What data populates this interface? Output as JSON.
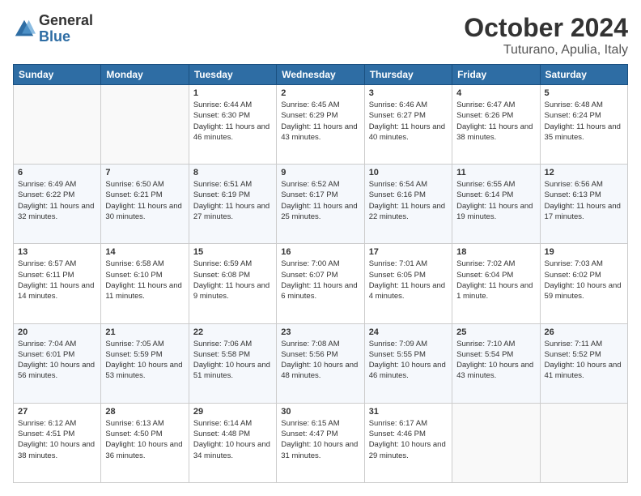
{
  "logo": {
    "general": "General",
    "blue": "Blue"
  },
  "title": "October 2024",
  "location": "Tuturano, Apulia, Italy",
  "weekdays": [
    "Sunday",
    "Monday",
    "Tuesday",
    "Wednesday",
    "Thursday",
    "Friday",
    "Saturday"
  ],
  "weeks": [
    [
      {
        "day": null
      },
      {
        "day": null
      },
      {
        "day": 1,
        "sunrise": "6:44 AM",
        "sunset": "6:30 PM",
        "daylight": "11 hours and 46 minutes."
      },
      {
        "day": 2,
        "sunrise": "6:45 AM",
        "sunset": "6:29 PM",
        "daylight": "11 hours and 43 minutes."
      },
      {
        "day": 3,
        "sunrise": "6:46 AM",
        "sunset": "6:27 PM",
        "daylight": "11 hours and 40 minutes."
      },
      {
        "day": 4,
        "sunrise": "6:47 AM",
        "sunset": "6:26 PM",
        "daylight": "11 hours and 38 minutes."
      },
      {
        "day": 5,
        "sunrise": "6:48 AM",
        "sunset": "6:24 PM",
        "daylight": "11 hours and 35 minutes."
      }
    ],
    [
      {
        "day": 6,
        "sunrise": "6:49 AM",
        "sunset": "6:22 PM",
        "daylight": "11 hours and 32 minutes."
      },
      {
        "day": 7,
        "sunrise": "6:50 AM",
        "sunset": "6:21 PM",
        "daylight": "11 hours and 30 minutes."
      },
      {
        "day": 8,
        "sunrise": "6:51 AM",
        "sunset": "6:19 PM",
        "daylight": "11 hours and 27 minutes."
      },
      {
        "day": 9,
        "sunrise": "6:52 AM",
        "sunset": "6:17 PM",
        "daylight": "11 hours and 25 minutes."
      },
      {
        "day": 10,
        "sunrise": "6:54 AM",
        "sunset": "6:16 PM",
        "daylight": "11 hours and 22 minutes."
      },
      {
        "day": 11,
        "sunrise": "6:55 AM",
        "sunset": "6:14 PM",
        "daylight": "11 hours and 19 minutes."
      },
      {
        "day": 12,
        "sunrise": "6:56 AM",
        "sunset": "6:13 PM",
        "daylight": "11 hours and 17 minutes."
      }
    ],
    [
      {
        "day": 13,
        "sunrise": "6:57 AM",
        "sunset": "6:11 PM",
        "daylight": "11 hours and 14 minutes."
      },
      {
        "day": 14,
        "sunrise": "6:58 AM",
        "sunset": "6:10 PM",
        "daylight": "11 hours and 11 minutes."
      },
      {
        "day": 15,
        "sunrise": "6:59 AM",
        "sunset": "6:08 PM",
        "daylight": "11 hours and 9 minutes."
      },
      {
        "day": 16,
        "sunrise": "7:00 AM",
        "sunset": "6:07 PM",
        "daylight": "11 hours and 6 minutes."
      },
      {
        "day": 17,
        "sunrise": "7:01 AM",
        "sunset": "6:05 PM",
        "daylight": "11 hours and 4 minutes."
      },
      {
        "day": 18,
        "sunrise": "7:02 AM",
        "sunset": "6:04 PM",
        "daylight": "11 hours and 1 minute."
      },
      {
        "day": 19,
        "sunrise": "7:03 AM",
        "sunset": "6:02 PM",
        "daylight": "10 hours and 59 minutes."
      }
    ],
    [
      {
        "day": 20,
        "sunrise": "7:04 AM",
        "sunset": "6:01 PM",
        "daylight": "10 hours and 56 minutes."
      },
      {
        "day": 21,
        "sunrise": "7:05 AM",
        "sunset": "5:59 PM",
        "daylight": "10 hours and 53 minutes."
      },
      {
        "day": 22,
        "sunrise": "7:06 AM",
        "sunset": "5:58 PM",
        "daylight": "10 hours and 51 minutes."
      },
      {
        "day": 23,
        "sunrise": "7:08 AM",
        "sunset": "5:56 PM",
        "daylight": "10 hours and 48 minutes."
      },
      {
        "day": 24,
        "sunrise": "7:09 AM",
        "sunset": "5:55 PM",
        "daylight": "10 hours and 46 minutes."
      },
      {
        "day": 25,
        "sunrise": "7:10 AM",
        "sunset": "5:54 PM",
        "daylight": "10 hours and 43 minutes."
      },
      {
        "day": 26,
        "sunrise": "7:11 AM",
        "sunset": "5:52 PM",
        "daylight": "10 hours and 41 minutes."
      }
    ],
    [
      {
        "day": 27,
        "sunrise": "6:12 AM",
        "sunset": "4:51 PM",
        "daylight": "10 hours and 38 minutes."
      },
      {
        "day": 28,
        "sunrise": "6:13 AM",
        "sunset": "4:50 PM",
        "daylight": "10 hours and 36 minutes."
      },
      {
        "day": 29,
        "sunrise": "6:14 AM",
        "sunset": "4:48 PM",
        "daylight": "10 hours and 34 minutes."
      },
      {
        "day": 30,
        "sunrise": "6:15 AM",
        "sunset": "4:47 PM",
        "daylight": "10 hours and 31 minutes."
      },
      {
        "day": 31,
        "sunrise": "6:17 AM",
        "sunset": "4:46 PM",
        "daylight": "10 hours and 29 minutes."
      },
      {
        "day": null
      },
      {
        "day": null
      }
    ]
  ]
}
